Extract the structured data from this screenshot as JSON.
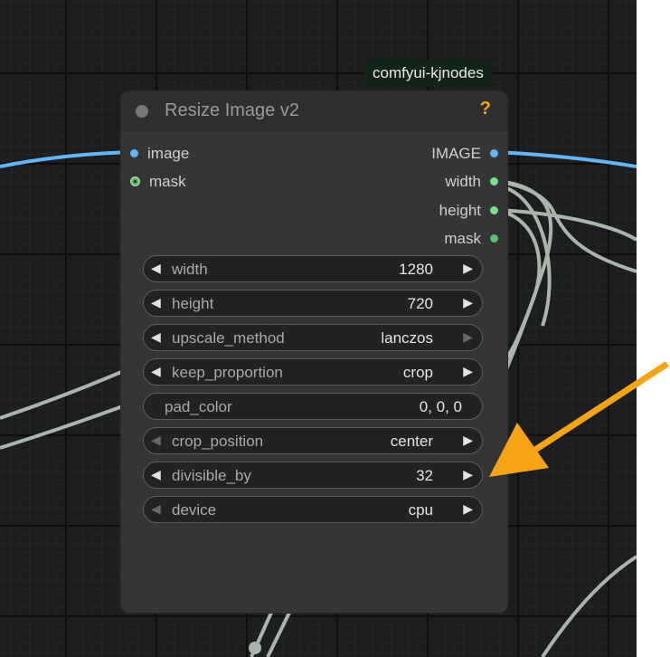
{
  "pack_badge": "comfyui-kjnodes",
  "node": {
    "title": "Resize Image v2",
    "help": "?",
    "inputs": [
      {
        "label": "image",
        "color": "#64b5f6"
      },
      {
        "label": "mask",
        "color": "#56c070"
      }
    ],
    "outputs": [
      {
        "label": "IMAGE",
        "color": "#64b5f6"
      },
      {
        "label": "width",
        "color": "#7ce08a"
      },
      {
        "label": "height",
        "color": "#7ce08a"
      },
      {
        "label": "mask",
        "color": "#56c070"
      }
    ],
    "widgets": [
      {
        "name": "width",
        "value": "1280"
      },
      {
        "name": "height",
        "value": "720"
      },
      {
        "name": "upscale_method",
        "value": "lanczos"
      },
      {
        "name": "keep_proportion",
        "value": "crop"
      },
      {
        "name": "pad_color",
        "value": "0, 0, 0"
      },
      {
        "name": "crop_position",
        "value": "center"
      },
      {
        "name": "divisible_by",
        "value": "32"
      },
      {
        "name": "device",
        "value": "cpu"
      }
    ]
  },
  "colors": {
    "image_link": "#64b5f6",
    "int_link": "#a9b5aa",
    "annotation_arrow": "#f5a416",
    "node_background": "#353535",
    "canvas_background": "#1c1d1f"
  }
}
